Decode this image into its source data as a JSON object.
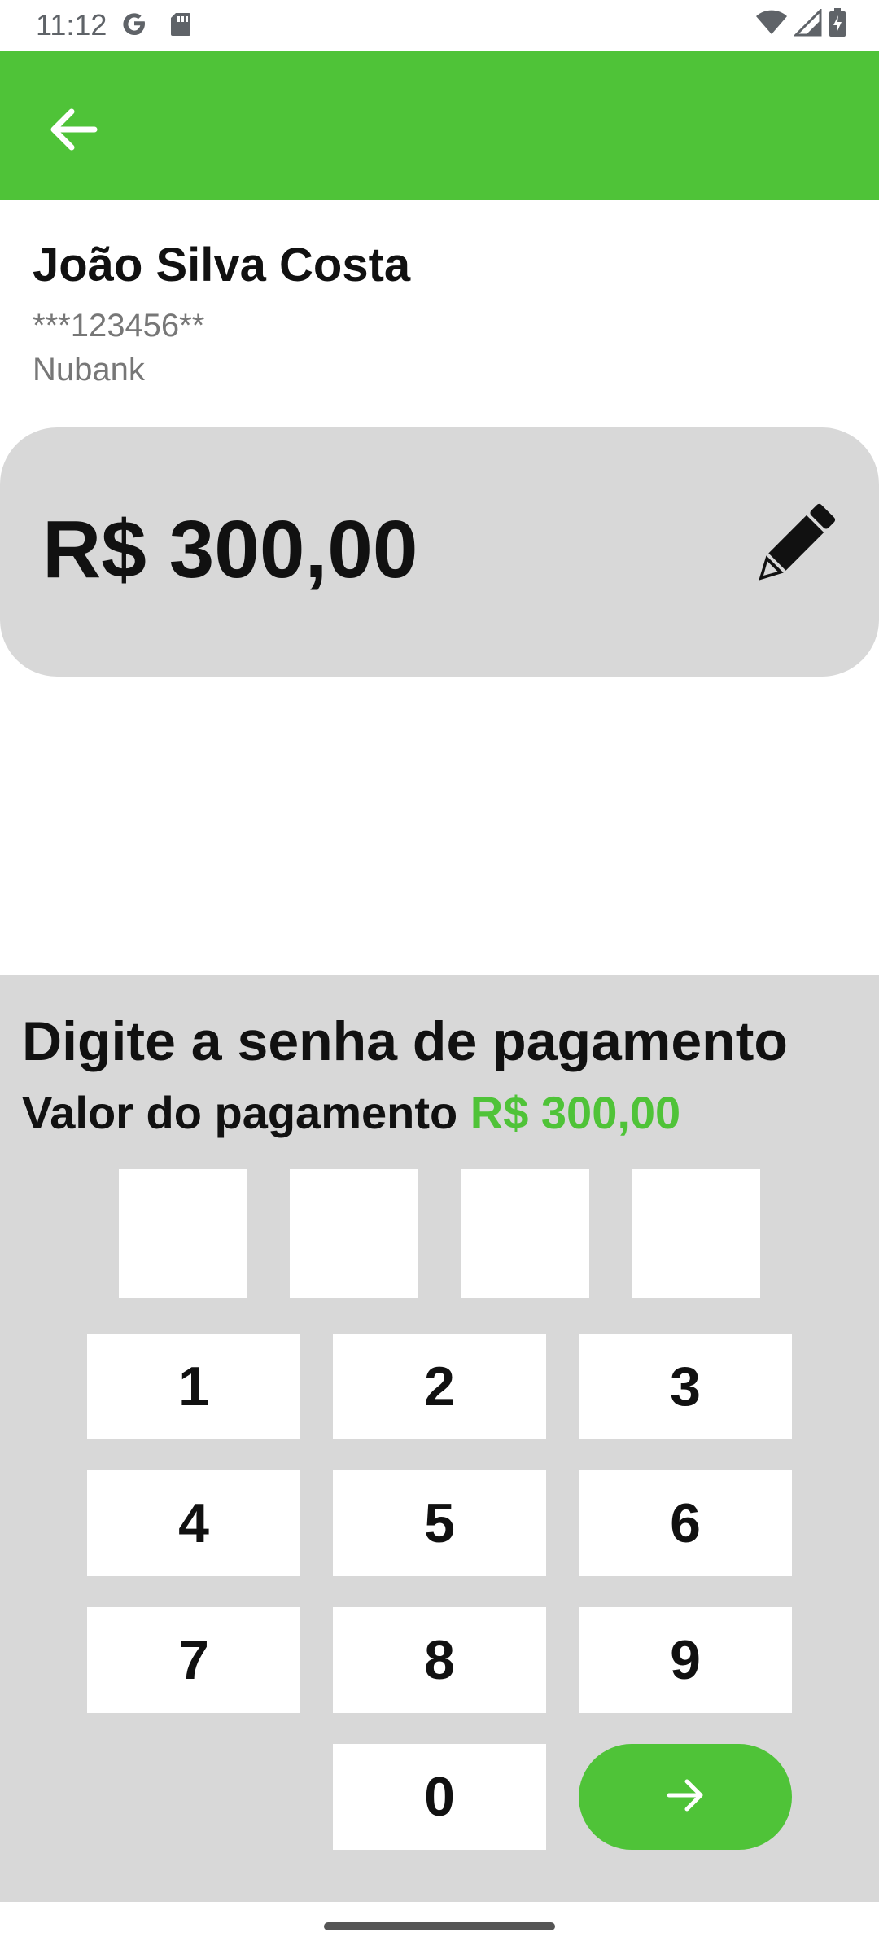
{
  "status_bar": {
    "time": "11:12",
    "icons": [
      "google-icon",
      "sd-card-icon",
      "wifi-icon",
      "signal-icon",
      "battery-charging-icon"
    ]
  },
  "app_bar": {
    "back_icon": "arrow-back-icon",
    "color": "#4fc338"
  },
  "recipient": {
    "name": "João Silva Costa",
    "key": "***123456**",
    "bank": "Nubank"
  },
  "amount_card": {
    "value": "R$ 300,00",
    "edit_icon": "pencil-icon"
  },
  "payment_panel": {
    "title": "Digite a senha de pagamento",
    "subtitle_label": "Valor do pagamento",
    "subtitle_amount": "R$ 300,00",
    "pin_length": 4,
    "keys": [
      "1",
      "2",
      "3",
      "4",
      "5",
      "6",
      "7",
      "8",
      "9",
      "0"
    ],
    "submit_icon": "arrow-forward-icon",
    "accent_color": "#4fc338"
  }
}
